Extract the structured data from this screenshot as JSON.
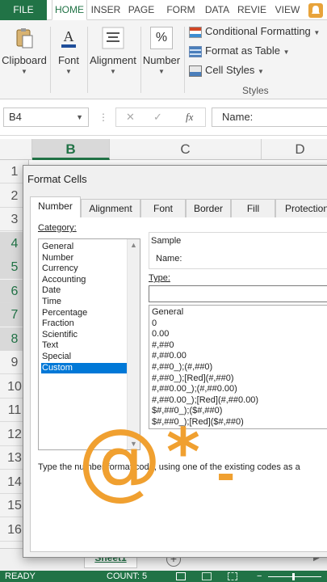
{
  "ribbon": {
    "tabs": [
      "FILE",
      "HOME",
      "INSER",
      "PAGE",
      "FORM",
      "DATA",
      "REVIE",
      "VIEW"
    ],
    "active_tab": "HOME",
    "groups": {
      "clipboard": "Clipboard",
      "font": "Font",
      "alignment": "Alignment",
      "number": "Number",
      "styles": "Styles"
    },
    "number_icon": "%",
    "styles_items": {
      "conditional": "Conditional Formatting",
      "format_table": "Format as Table",
      "cell_styles": "Cell Styles"
    }
  },
  "formula_bar": {
    "name_box": "B4",
    "fx": "fx",
    "content": "Name:"
  },
  "sheet": {
    "columns": [
      "B",
      "C",
      "D"
    ],
    "selected_column": "B",
    "rows": [
      "1",
      "2",
      "3",
      "4",
      "5",
      "6",
      "7",
      "8",
      "9",
      "10",
      "11",
      "12",
      "13",
      "14",
      "15",
      "16"
    ],
    "selected_rows": [
      "4",
      "5",
      "6",
      "7",
      "8"
    ],
    "tab_name": "Sheet1"
  },
  "status_bar": {
    "mode": "READY",
    "count": "COUNT: 5"
  },
  "dialog": {
    "title": "Format Cells",
    "tabs": [
      "Number",
      "Alignment",
      "Font",
      "Border",
      "Fill",
      "Protection"
    ],
    "active_tab": "Number",
    "category_label": "Category:",
    "categories": [
      "General",
      "Number",
      "Currency",
      "Accounting",
      "Date",
      "Time",
      "Percentage",
      "Fraction",
      "Scientific",
      "Text",
      "Special",
      "Custom"
    ],
    "selected_category": "Custom",
    "sample_label": "Sample",
    "sample_value": "Name:",
    "type_label": "Type:",
    "type_value": "",
    "type_codes": [
      "General",
      "0",
      "0.00",
      "#,##0",
      "#,##0.00",
      "#,##0_);(#,##0)",
      "#,##0_);[Red](#,##0)",
      "#,##0.00_);(#,##0.00)",
      "#,##0.00_);[Red](#,##0.00)",
      "$#,##0_);($#,##0)",
      "$#,##0_);[Red]($#,##0)"
    ],
    "help_text": "Type the number format code, using one of the existing codes as a"
  },
  "watermark": {
    "at": "@",
    "star": "*",
    "dash": "-"
  },
  "colors": {
    "excel_green": "#217346",
    "selection_blue": "#0078d7",
    "watermark_orange": "#f0a030"
  }
}
